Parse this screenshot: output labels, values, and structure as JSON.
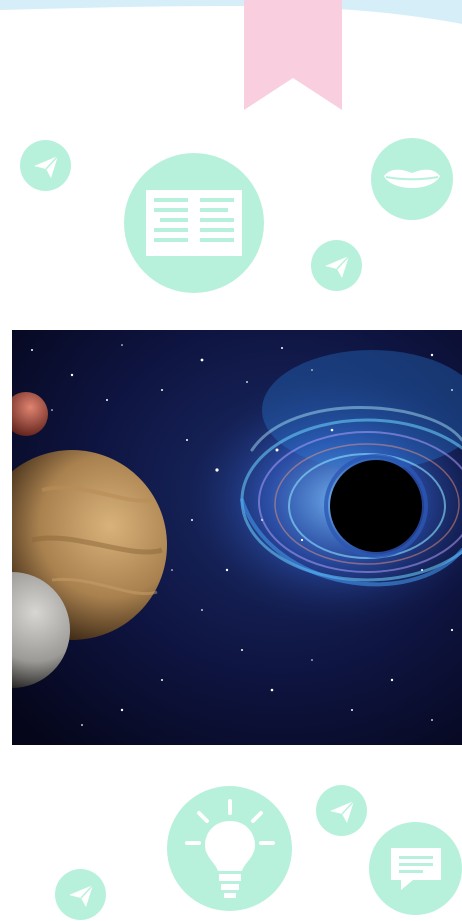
{
  "colors": {
    "mint": "#b7f1dc",
    "pink": "#f9cfe0",
    "arc": "#d6eef8",
    "white": "#ffffff",
    "space_dark": "#0a0c2a",
    "planet_tan": "#c8a06a",
    "moon_gray": "#b9b7b4",
    "red_planet": "#c45a4a",
    "nebula_blue": "#2d63c9"
  },
  "icons": {
    "bookmark": "bookmark-ribbon",
    "paper_plane_small_1": "paper-plane-icon",
    "reading": "book-icon",
    "speech": "lips-icon",
    "paper_plane_small_2": "paper-plane-icon",
    "idea": "lightbulb-icon",
    "paper_plane_small_3": "paper-plane-icon",
    "paper_plane_small_4": "paper-plane-icon",
    "message": "chat-bubble-icon"
  },
  "image": {
    "subject": "space-scene-black-hole-planets"
  }
}
